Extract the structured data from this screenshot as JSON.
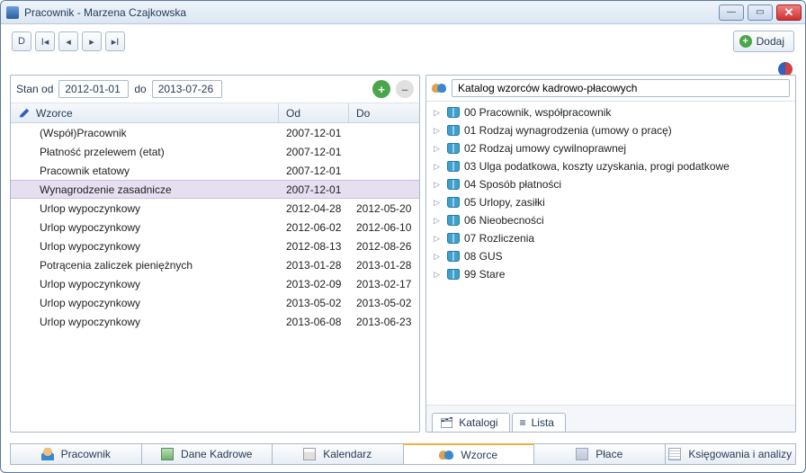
{
  "window": {
    "title": "Pracownik - Marzena Czajkowska"
  },
  "toolbar": {
    "add_label": "Dodaj"
  },
  "filter": {
    "stan_od_label": "Stan od",
    "date_from": "2012-01-01",
    "do_label": "do",
    "date_to": "2013-07-26"
  },
  "grid": {
    "headers": {
      "wzorce": "Wzorce",
      "od": "Od",
      "do": "Do"
    },
    "rows": [
      {
        "name": "(Współ)Pracownik",
        "od": "2007-12-01",
        "do": ""
      },
      {
        "name": "Płatność przelewem (etat)",
        "od": "2007-12-01",
        "do": ""
      },
      {
        "name": "Pracownik etatowy",
        "od": "2007-12-01",
        "do": ""
      },
      {
        "name": "Wynagrodzenie zasadnicze",
        "od": "2007-12-01",
        "do": "",
        "selected": true
      },
      {
        "name": "Urlop wypoczynkowy",
        "od": "2012-04-28",
        "do": "2012-05-20"
      },
      {
        "name": "Urlop wypoczynkowy",
        "od": "2012-06-02",
        "do": "2012-06-10"
      },
      {
        "name": "Urlop wypoczynkowy",
        "od": "2012-08-13",
        "do": "2012-08-26"
      },
      {
        "name": "Potrącenia zaliczek pieniężnych",
        "od": "2013-01-28",
        "do": "2013-01-28"
      },
      {
        "name": "Urlop wypoczynkowy",
        "od": "2013-02-09",
        "do": "2013-02-17"
      },
      {
        "name": "Urlop wypoczynkowy",
        "od": "2013-05-02",
        "do": "2013-05-02"
      },
      {
        "name": "Urlop wypoczynkowy",
        "od": "2013-06-08",
        "do": "2013-06-23"
      }
    ]
  },
  "tree": {
    "title": "Katalog wzorców kadrowo-płacowych",
    "items": [
      "00 Pracownik, współpracownik",
      "01 Rodzaj wynagrodzenia (umowy o pracę)",
      "02 Rodzaj umowy cywilnoprawnej",
      "03 Ulga podatkowa, koszty uzyskania, progi podatkowe",
      "04 Sposób płatności",
      "05 Urlopy, zasiłki",
      "06 Nieobecności",
      "07 Rozliczenia",
      "08 GUS",
      "99 Stare"
    ]
  },
  "right_tabs": {
    "katalogi": "Katalogi",
    "lista": "Lista"
  },
  "bottom_tabs": {
    "pracownik": "Pracownik",
    "dane_kadrowe": "Dane Kadrowe",
    "kalendarz": "Kalendarz",
    "wzorce": "Wzorce",
    "place": "Płace",
    "ksiegowania": "Księgowania i analizy"
  }
}
